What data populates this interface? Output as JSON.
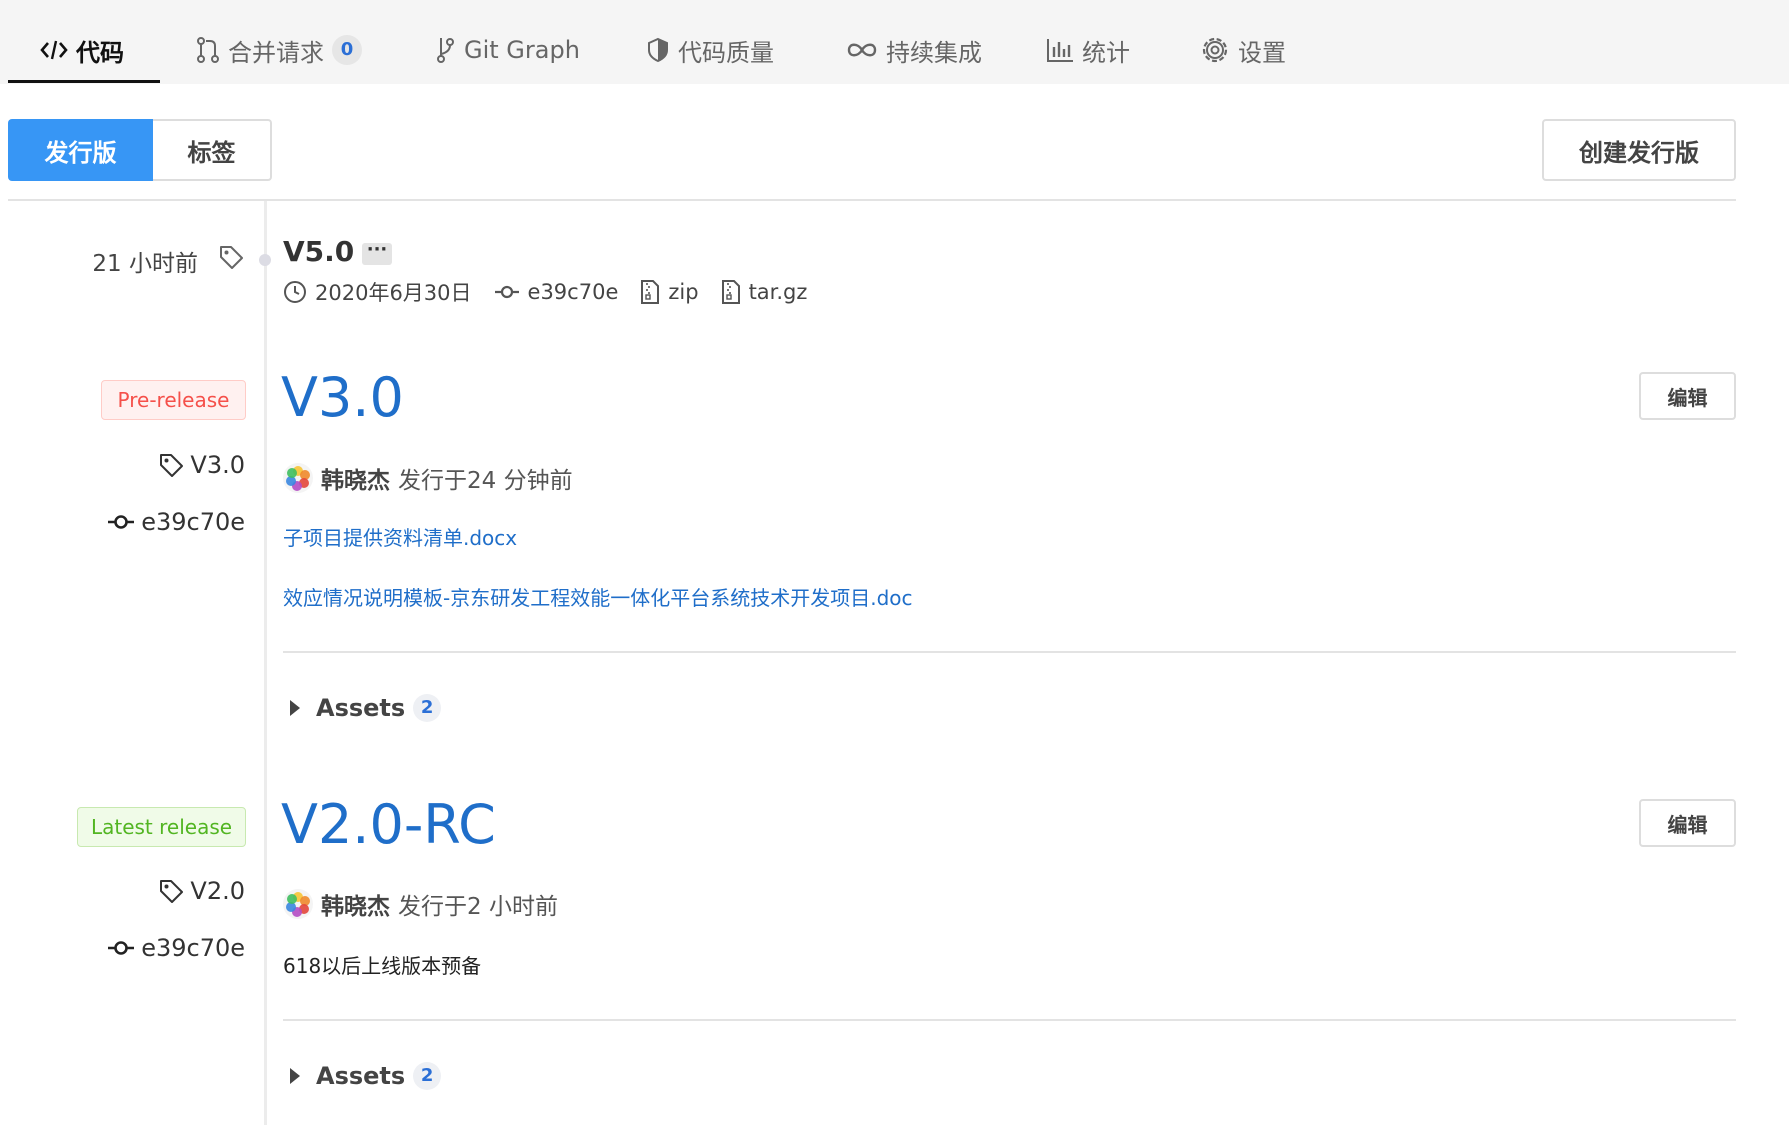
{
  "tabs": [
    {
      "label": "代码",
      "icon": "code-icon",
      "active": true
    },
    {
      "label": "合并请求",
      "icon": "merge-request-icon",
      "badge": "0"
    },
    {
      "label": "Git Graph",
      "icon": "git-branch-icon"
    },
    {
      "label": "代码质量",
      "icon": "shield-icon"
    },
    {
      "label": "持续集成",
      "icon": "infinity-icon"
    },
    {
      "label": "统计",
      "icon": "bar-chart-icon"
    },
    {
      "label": "设置",
      "icon": "gear-icon"
    }
  ],
  "toggle": {
    "releases": "发行版",
    "tags": "标签"
  },
  "create_release": "创建发行版",
  "tag_entry": {
    "ago": "21 小时前",
    "name": "V5.0",
    "more": "···",
    "date": "2020年6月30日",
    "commit": "e39c70e",
    "zip": "zip",
    "targz": "tar.gz"
  },
  "releases": [
    {
      "badge": "Pre-release",
      "tag": "V3.0",
      "commit": "e39c70e",
      "title": "V3.0",
      "edit": "编辑",
      "author": "韩晓杰",
      "published": "发行于24 分钟前",
      "links": [
        "子项目提供资料清单.docx",
        "效应情况说明模板-京东研发工程效能一体化平台系统技术开发项目.doc"
      ],
      "assets_label": "Assets",
      "assets_count": "2"
    },
    {
      "badge": "Latest release",
      "tag": "V2.0",
      "commit": "e39c70e",
      "title": "V2.0-RC",
      "edit": "编辑",
      "author": "韩晓杰",
      "published": "发行于2 小时前",
      "note": "618以后上线版本预备",
      "assets_label": "Assets",
      "assets_count": "2"
    }
  ],
  "colors": {
    "accent": "#3796f5",
    "link": "#1f6ec9",
    "pre_release": "#f5504a",
    "latest_release": "#52b522"
  }
}
